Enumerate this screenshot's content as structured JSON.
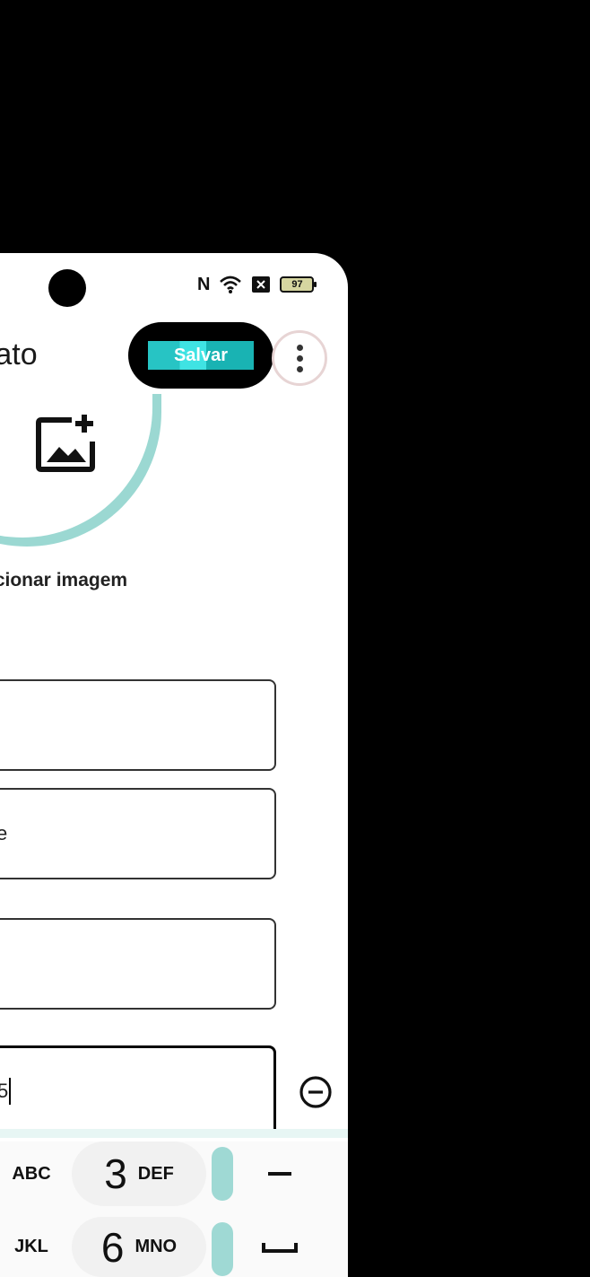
{
  "status_bar": {
    "nfc_icon": "nfc-icon",
    "wifi_icon": "wifi-icon",
    "sim_icon": "sim-icon",
    "battery_level": "97"
  },
  "header": {
    "title": "ntato",
    "save_label": "Salvar",
    "more_icon": "more-vertical-icon"
  },
  "photo": {
    "icon": "add-image-icon",
    "label": "icionar imagem"
  },
  "fields": [
    {
      "value": ""
    },
    {
      "value": "e"
    },
    {
      "value": ""
    },
    {
      "value": "5"
    }
  ],
  "keyboard": {
    "rows": [
      {
        "left_label": "ABC",
        "digit": "3",
        "digit_sub": "DEF",
        "right_label": "–"
      },
      {
        "left_label": "JKL",
        "digit": "6",
        "digit_sub": "MNO",
        "right_label": "␣"
      }
    ]
  },
  "colors": {
    "accent": "#27c4c4",
    "background": "#ffffff",
    "frame": "#000000"
  }
}
